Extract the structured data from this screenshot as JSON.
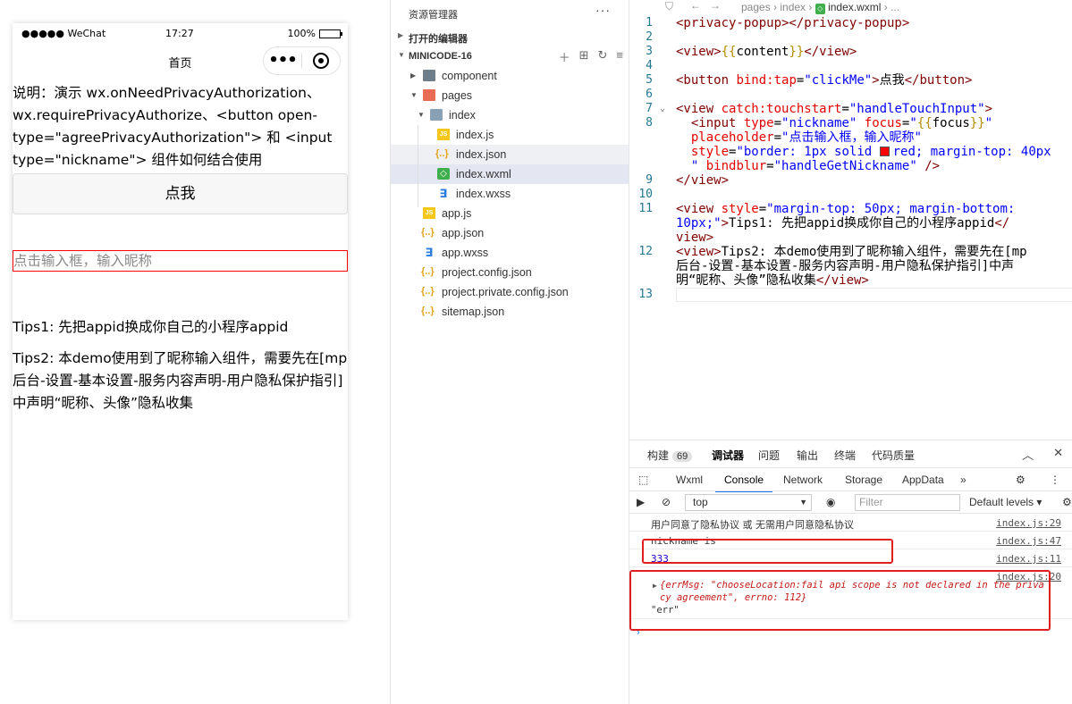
{
  "simulator": {
    "status": {
      "carrier": "●●●●● WeChat",
      "time": "17:27",
      "battery": "100%",
      "battery_level": 1.0
    },
    "nav_title": "首页",
    "description": "说明：演示 wx.onNeedPrivacyAuthorization、wx.requirePrivacyAuthorize、<button open-type=\"agreePrivacyAuthorization\"> 和 <input type=\"nickname\"> 组件如何结合使用",
    "button_label": "点我",
    "input_placeholder": "点击输入框，输入昵称",
    "tips1": "Tips1: 先把appid换成你自己的小程序appid",
    "tips2": "Tips2: 本demo使用到了昵称输入组件，需要先在[mp后台-设置-基本设置-服务内容声明-用户隐私保护指引]中声明“昵称、头像”隐私收集"
  },
  "explorer": {
    "title": "资源管理器",
    "more": "···",
    "section_open_editors": "打开的编辑器",
    "project": "MINICODE-16",
    "tree": [
      {
        "name": "component",
        "type": "folder"
      },
      {
        "name": "pages",
        "type": "folder"
      },
      {
        "name": "index",
        "type": "folder"
      },
      {
        "name": "index.js",
        "type": "js"
      },
      {
        "name": "index.json",
        "type": "json"
      },
      {
        "name": "index.wxml",
        "type": "wxml"
      },
      {
        "name": "index.wxss",
        "type": "wxss"
      },
      {
        "name": "app.js",
        "type": "js"
      },
      {
        "name": "app.json",
        "type": "json"
      },
      {
        "name": "app.wxss",
        "type": "wxss"
      },
      {
        "name": "project.config.json",
        "type": "json"
      },
      {
        "name": "project.private.config.json",
        "type": "json"
      },
      {
        "name": "sitemap.json",
        "type": "json"
      }
    ]
  },
  "editor": {
    "breadcrumb": "pages  ›  index  ›  ",
    "file": "index.wxml",
    "breadcrumb_tail": " › ...",
    "line_numbers": [
      "1",
      "2",
      "3",
      "4",
      "5",
      "6",
      "7",
      "8",
      "9",
      "10",
      "11",
      "12",
      "13"
    ]
  },
  "panel": {
    "tabs": [
      {
        "label": "构建",
        "badge": "69"
      },
      {
        "label": "调试器"
      },
      {
        "label": "问题"
      },
      {
        "label": "输出"
      },
      {
        "label": "终端"
      },
      {
        "label": "代码质量"
      }
    ],
    "devtools_tabs": [
      "Wxml",
      "Console",
      "Network",
      "Storage",
      "AppData",
      "»"
    ],
    "context": "top",
    "filter_placeholder": "Filter",
    "levels": "Default levels ▾",
    "messages": [
      {
        "text": "用户同意了隐私协议 或 无需用户同意隐私协议",
        "source": "index.js:29"
      },
      {
        "text": "nickname is",
        "source": "index.js:47"
      },
      {
        "text": "333",
        "source": "index.js:11"
      },
      {
        "text": "",
        "source": "index.js:20"
      }
    ],
    "err_obj_line1": "{errMsg: \"chooseLocation:fail api scope is not declared in the priva",
    "err_obj_line2": "cy agreement\", errno: 112}",
    "err_string": "\"err\""
  }
}
